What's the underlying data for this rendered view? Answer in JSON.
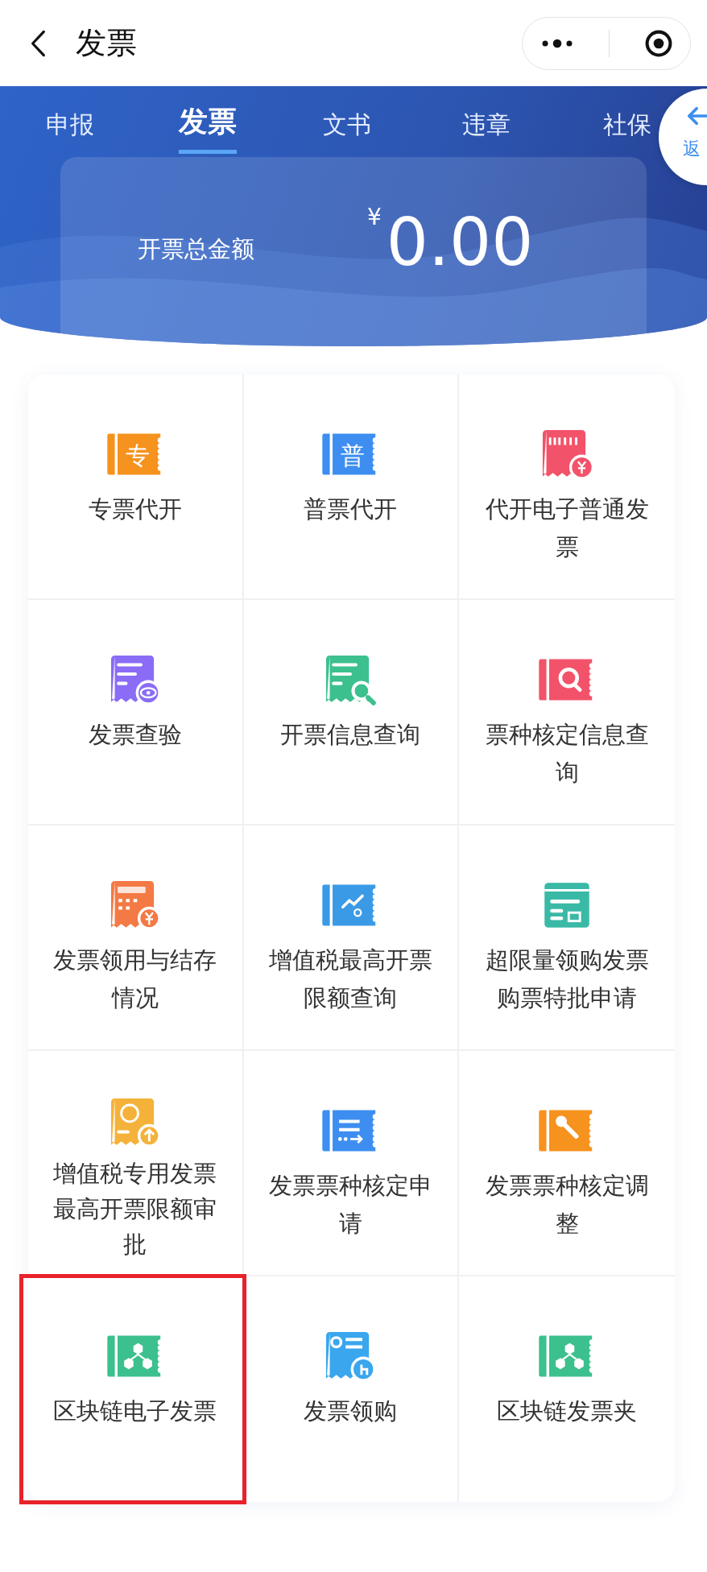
{
  "header": {
    "title": "发票"
  },
  "tabs": [
    {
      "label": "申报",
      "selected": false
    },
    {
      "label": "发票",
      "selected": true
    },
    {
      "label": "文书",
      "selected": false
    },
    {
      "label": "违章",
      "selected": false
    },
    {
      "label": "社保",
      "selected": false
    }
  ],
  "side_button": {
    "label": "返"
  },
  "summary": {
    "label": "开票总金额",
    "currency": "¥",
    "amount": "0.00"
  },
  "services": [
    {
      "label": "专票代开",
      "kind": "ticket-char",
      "icon_text": "专",
      "color": "#f6921e",
      "highlighted": false
    },
    {
      "label": "普票代开",
      "kind": "ticket-char",
      "icon_text": "普",
      "color": "#3d8ef0",
      "highlighted": false
    },
    {
      "label": "代开电子普通发票",
      "kind": "receipt-coin",
      "color": "#f2536a",
      "highlighted": false
    },
    {
      "label": "发票查验",
      "kind": "doc-eye",
      "color": "#8a6cf6",
      "highlighted": false
    },
    {
      "label": "开票信息查询",
      "kind": "doc-search",
      "color": "#3cc08e",
      "highlighted": false
    },
    {
      "label": "票种核定信息查询",
      "kind": "ticket-search",
      "color": "#f2536a",
      "highlighted": false
    },
    {
      "label": "发票领用与结存情况",
      "kind": "calculator",
      "color": "#f47a45",
      "highlighted": false
    },
    {
      "label": "增值税最高开票限额查询",
      "kind": "ticket-chart",
      "color": "#3a9ae6",
      "highlighted": false
    },
    {
      "label": "超限量领购发票购票特批申请",
      "kind": "wallet",
      "color": "#3ab9a6",
      "highlighted": false
    },
    {
      "label": "增值税专用发票最高开票限额审批",
      "kind": "doc-coin",
      "color": "#f5b23a",
      "highlighted": false
    },
    {
      "label": "发票票种核定申请",
      "kind": "ticket-list",
      "color": "#3d8ef0",
      "highlighted": false
    },
    {
      "label": "发票票种核定调整",
      "kind": "ticket-wrench",
      "color": "#f6921e",
      "highlighted": false
    },
    {
      "label": "区块链电子发票",
      "kind": "ticket-chain",
      "color": "#3cc08e",
      "highlighted": true
    },
    {
      "label": "发票领购",
      "kind": "doc-hand",
      "color": "#3aa6ee",
      "highlighted": false
    },
    {
      "label": "区块链发票夹",
      "kind": "ticket-chain",
      "color": "#3cc08e",
      "highlighted": false
    }
  ]
}
